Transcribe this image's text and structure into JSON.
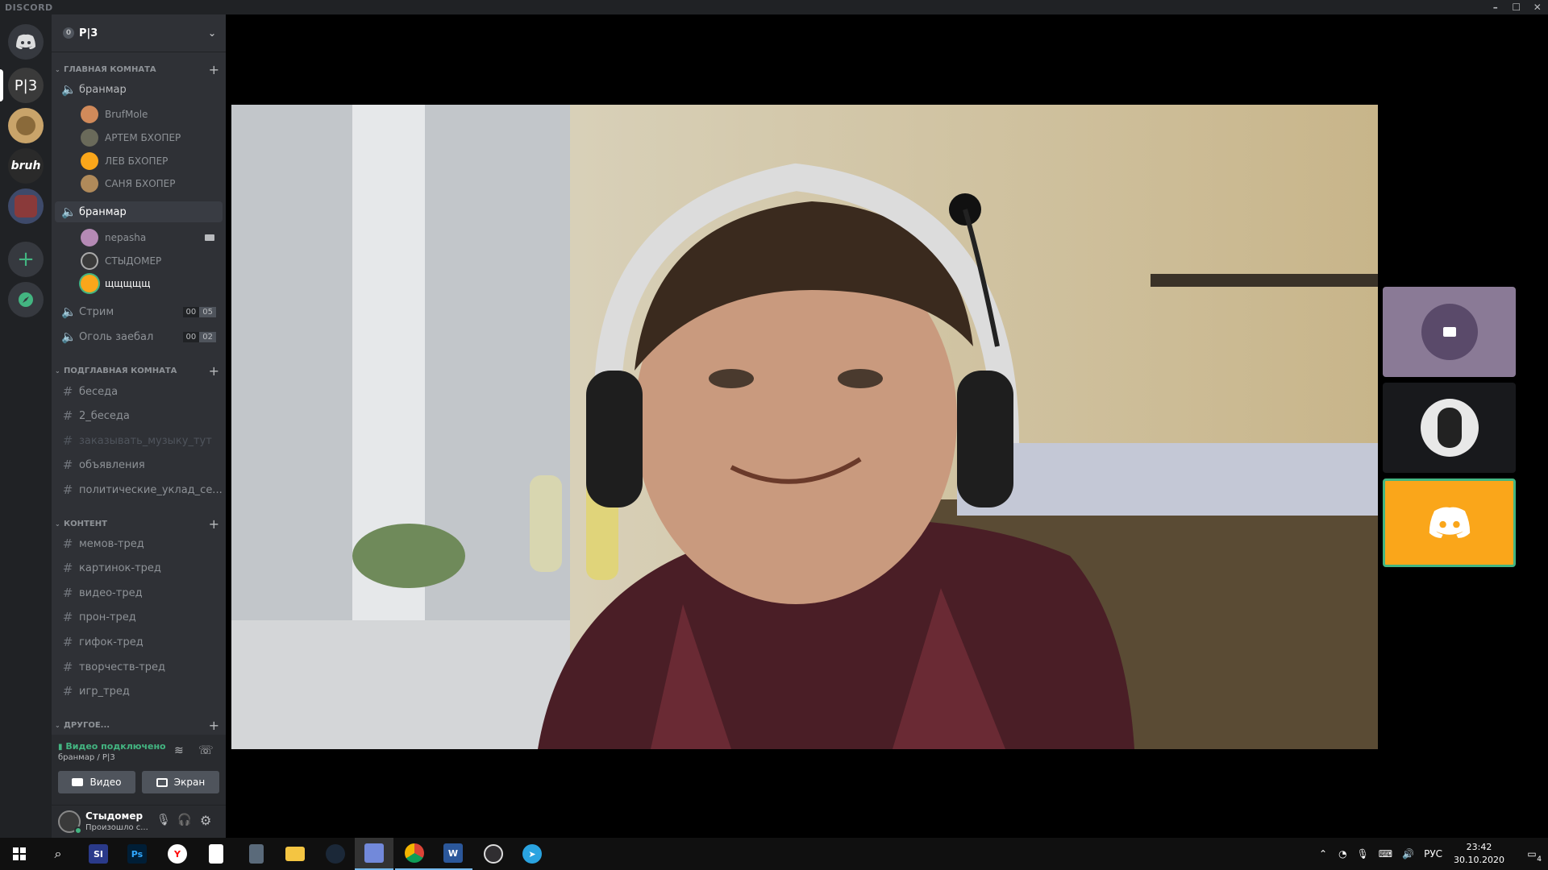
{
  "app": {
    "title": "DISCORD"
  },
  "server": {
    "name": "P|3",
    "badge": "0"
  },
  "categories": {
    "main": "ГЛАВНАЯ КОМНАТА",
    "sub": "ПОДГЛАВНАЯ КОМНАТА",
    "content": "КОНТЕНТ",
    "other": "ДРУГОЕ..."
  },
  "voice_channels": {
    "ch1": {
      "name": "бранмар",
      "users": [
        "BrufMole",
        "АРТЕМ БХОПЕР",
        "ЛЕВ БХОПЕР",
        "САНЯ БХОПЕР"
      ]
    },
    "ch2": {
      "name": "бранмар",
      "users": [
        "nepasha",
        "СТЫДОМЕР",
        "щщщщщ"
      ]
    },
    "ch3": {
      "name": "Стрим",
      "count_a": "00",
      "count_b": "05"
    },
    "ch4": {
      "name": "Оголь заебал",
      "count_a": "00",
      "count_b": "02"
    }
  },
  "text_channels_sub": [
    "беседа",
    "2_беседа",
    "заказывать_музыку_тут",
    "объявления",
    "политические_уклад_се..."
  ],
  "text_channels_content": [
    "мемов-тред",
    "картинок-тред",
    "видео-тред",
    "прон-тред",
    "гифок-тред",
    "творчеств-тред",
    "игр_тред"
  ],
  "voice_panel": {
    "status": "Видео подключено",
    "location": "бранмар / P|3",
    "video_label": "Видео",
    "screen_label": "Экран"
  },
  "user_panel": {
    "name": "Стыдомер",
    "status": "Произошло с..."
  },
  "taskbar": {
    "lang": "РУС",
    "time": "23:42",
    "date": "30.10.2020",
    "notifications": "4"
  },
  "colors": {
    "accent": "#7289da",
    "online": "#43b581",
    "tile_orange": "#faa61a"
  }
}
